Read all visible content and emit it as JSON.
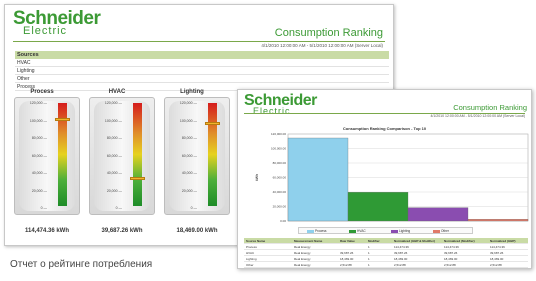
{
  "back_report": {
    "logo_line1": "Schneider",
    "logo_line2": "Electric",
    "title": "Consumption Ranking",
    "date_range": "4/1/2010 12:00:00 AM - 5/1/2010 12:00:00 AM (Server Local)",
    "sources_header": "Sources",
    "sources": [
      "HVAC",
      "Lighting",
      "Other",
      "Process"
    ],
    "gauges": [
      {
        "title": "Process",
        "value": "114,474.36 kWh",
        "ticks": [
          "120,000",
          "100,000",
          "80,000",
          "60,000",
          "40,000",
          "20,000",
          "0"
        ],
        "marker_fraction": 0.86
      },
      {
        "title": "HVAC",
        "value": "39,687.26 kWh",
        "ticks": [
          "120,000",
          "100,000",
          "80,000",
          "60,000",
          "40,000",
          "20,000",
          "0"
        ],
        "marker_fraction": 0.3
      },
      {
        "title": "Lighting",
        "value": "18,469.00 kWh",
        "ticks": [
          "120,000",
          "100,000",
          "80,000",
          "60,000",
          "40,000",
          "20,000",
          "0"
        ],
        "marker_fraction": 0.82
      }
    ]
  },
  "front_report": {
    "logo_line1": "Schneider",
    "logo_line2": "Electric",
    "title": "Consumption Ranking",
    "date_range": "4/1/2010 12:00:00 AM - 5/1/2010 12:00:00 AM (Server Local)",
    "chart_title": "Consumption Ranking Comparison - Top 10",
    "table_headers": [
      "Source Name",
      "Measurement Name",
      "Raw Value",
      "Modifier",
      "Normalized (GBP & Modifier)",
      "Normalized (Modifier)",
      "Normalized (GBP)"
    ],
    "table_rows": [
      [
        "Process",
        "Real Energy",
        "",
        "1",
        "114,474.36",
        "114,474.36",
        "114,474.36"
      ],
      [
        "HVAC",
        "Real Energy",
        "39,687.26",
        "1",
        "39,687.26",
        "39,687.26",
        "39,687.26"
      ],
      [
        "Lighting",
        "Real Energy",
        "18,469.00",
        "1",
        "18,469.00",
        "18,469.00",
        "18,469.00"
      ],
      [
        "Other",
        "Real Energy",
        "2,512.88",
        "1",
        "2,512.88",
        "2,512.88",
        "2,512.88"
      ]
    ]
  },
  "chart_data": {
    "type": "bar",
    "title": "Consumption Ranking Comparison - Top 10",
    "ylabel": "kWh",
    "categories": [
      "Process",
      "HVAC",
      "Lighting",
      "Other"
    ],
    "values": [
      114474.36,
      39687.26,
      18469.0,
      2512.88
    ],
    "ylim": [
      0,
      120000
    ],
    "yticks": [
      "120,000.00",
      "100,000.00",
      "80,000.00",
      "60,000.00",
      "40,000.00",
      "20,000.00",
      "0.00"
    ],
    "grid": true,
    "legend_placement": "bottom",
    "colors": [
      "#8fd0ec",
      "#2f9a35",
      "#8a4db0",
      "#e07a68"
    ]
  },
  "caption": "Отчет о рейтинге потребления"
}
